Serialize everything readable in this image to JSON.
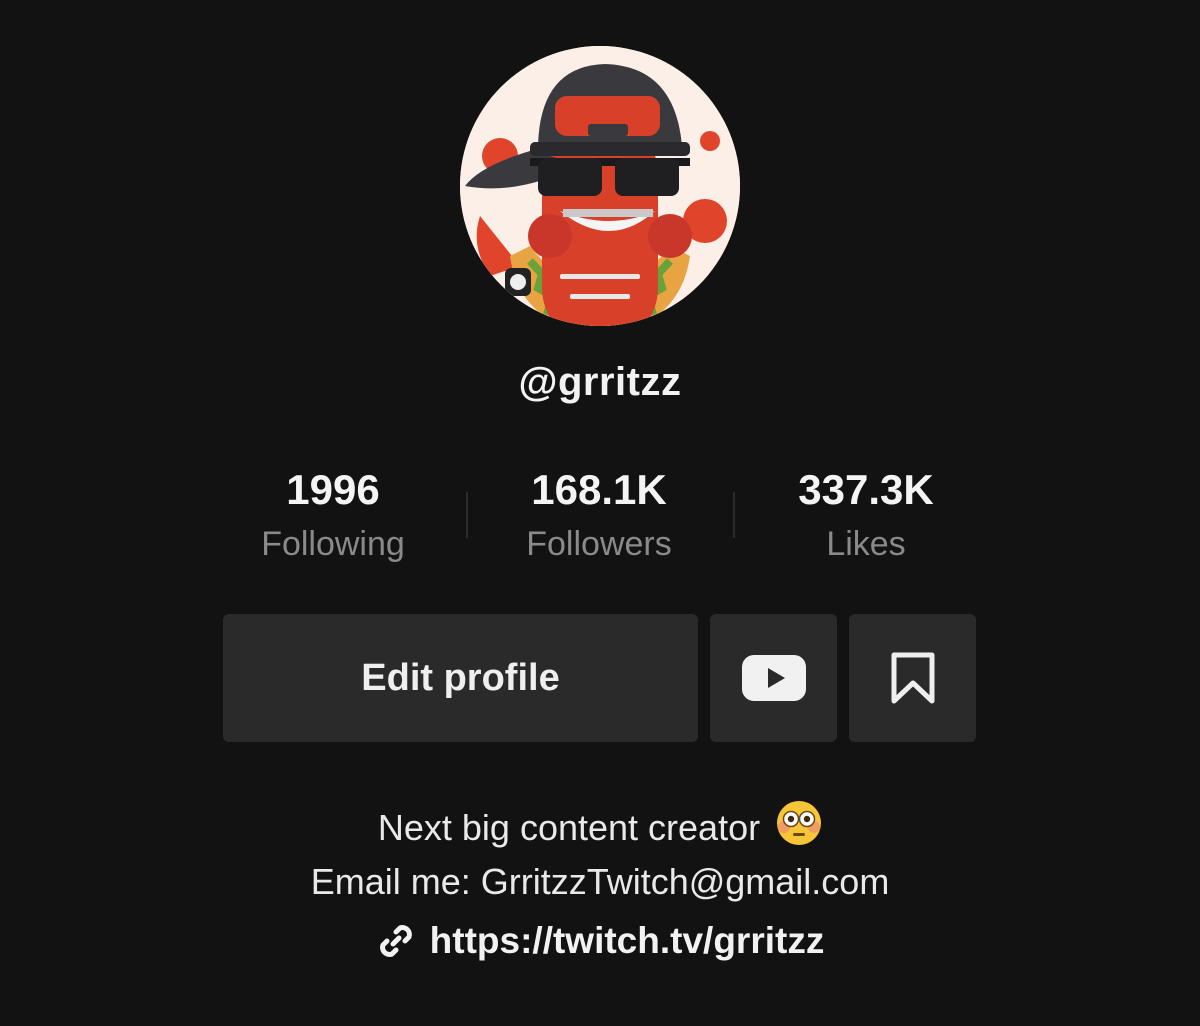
{
  "profile": {
    "username": "@grritzz",
    "avatar_icon": "hotdog-mascot-avatar"
  },
  "stats": [
    {
      "value": "1996",
      "label": "Following"
    },
    {
      "value": "168.1K",
      "label": "Followers"
    },
    {
      "value": "337.3K",
      "label": "Likes"
    }
  ],
  "actions": {
    "edit_label": "Edit profile",
    "youtube_icon": "youtube-icon",
    "bookmark_icon": "bookmark-icon"
  },
  "bio": {
    "line1": "Next big content creator",
    "emoji": "flushed-face-emoji",
    "line2": "Email me: GrritzzTwitch@gmail.com"
  },
  "link": {
    "icon": "link-icon",
    "text": "https://twitch.tv/grritzz"
  },
  "colors": {
    "background": "#121212",
    "button": "#2a2a2a",
    "label_gray": "#8a8a8a"
  }
}
